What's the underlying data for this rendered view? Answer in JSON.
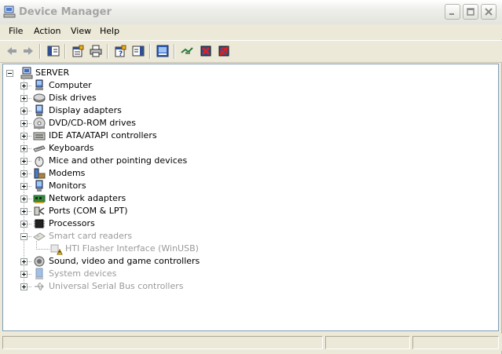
{
  "window": {
    "title": "Device Manager"
  },
  "menu": [
    "File",
    "Action",
    "View",
    "Help"
  ],
  "toolbar": {
    "buttons": [
      "back-icon",
      "forward-icon",
      "show-hide-tree-icon",
      "properties-icon",
      "print-icon",
      "help-icon",
      "show-hide-action-pane-icon",
      "scan-hardware-icon",
      "update-driver-icon",
      "uninstall-icon",
      "disable-icon"
    ]
  },
  "tree": {
    "root": "SERVER",
    "items": [
      {
        "label": "Computer",
        "icon": "computer-icon",
        "dim": false
      },
      {
        "label": "Disk drives",
        "icon": "disk-drive-icon",
        "dim": false
      },
      {
        "label": "Display adapters",
        "icon": "display-adapter-icon",
        "dim": false
      },
      {
        "label": "DVD/CD-ROM drives",
        "icon": "cdrom-icon",
        "dim": false
      },
      {
        "label": "IDE ATA/ATAPI controllers",
        "icon": "ide-controller-icon",
        "dim": false
      },
      {
        "label": "Keyboards",
        "icon": "keyboard-icon",
        "dim": false
      },
      {
        "label": "Mice and other pointing devices",
        "icon": "mouse-icon",
        "dim": false
      },
      {
        "label": "Modems",
        "icon": "modem-icon",
        "dim": false
      },
      {
        "label": "Monitors",
        "icon": "monitor-icon",
        "dim": false
      },
      {
        "label": "Network adapters",
        "icon": "network-adapter-icon",
        "dim": false
      },
      {
        "label": "Ports (COM & LPT)",
        "icon": "port-icon",
        "dim": false
      },
      {
        "label": "Processors",
        "icon": "processor-icon",
        "dim": false
      },
      {
        "label": "Smart card readers",
        "icon": "smart-card-reader-icon",
        "dim": true,
        "expanded": true,
        "children": [
          {
            "label": "HTI Flasher Interface (WinUSB)",
            "icon": "warning-device-icon",
            "dim": true
          }
        ]
      },
      {
        "label": "Sound, video and game controllers",
        "icon": "sound-icon",
        "dim": false
      },
      {
        "label": "System devices",
        "icon": "system-device-icon",
        "dim": true
      },
      {
        "label": "Universal Serial Bus controllers",
        "icon": "usb-icon",
        "dim": true
      }
    ]
  },
  "colors": {
    "tree_border": "#7f9db9",
    "dim_text": "#9a9a9a",
    "chrome": "#ece9d8"
  }
}
